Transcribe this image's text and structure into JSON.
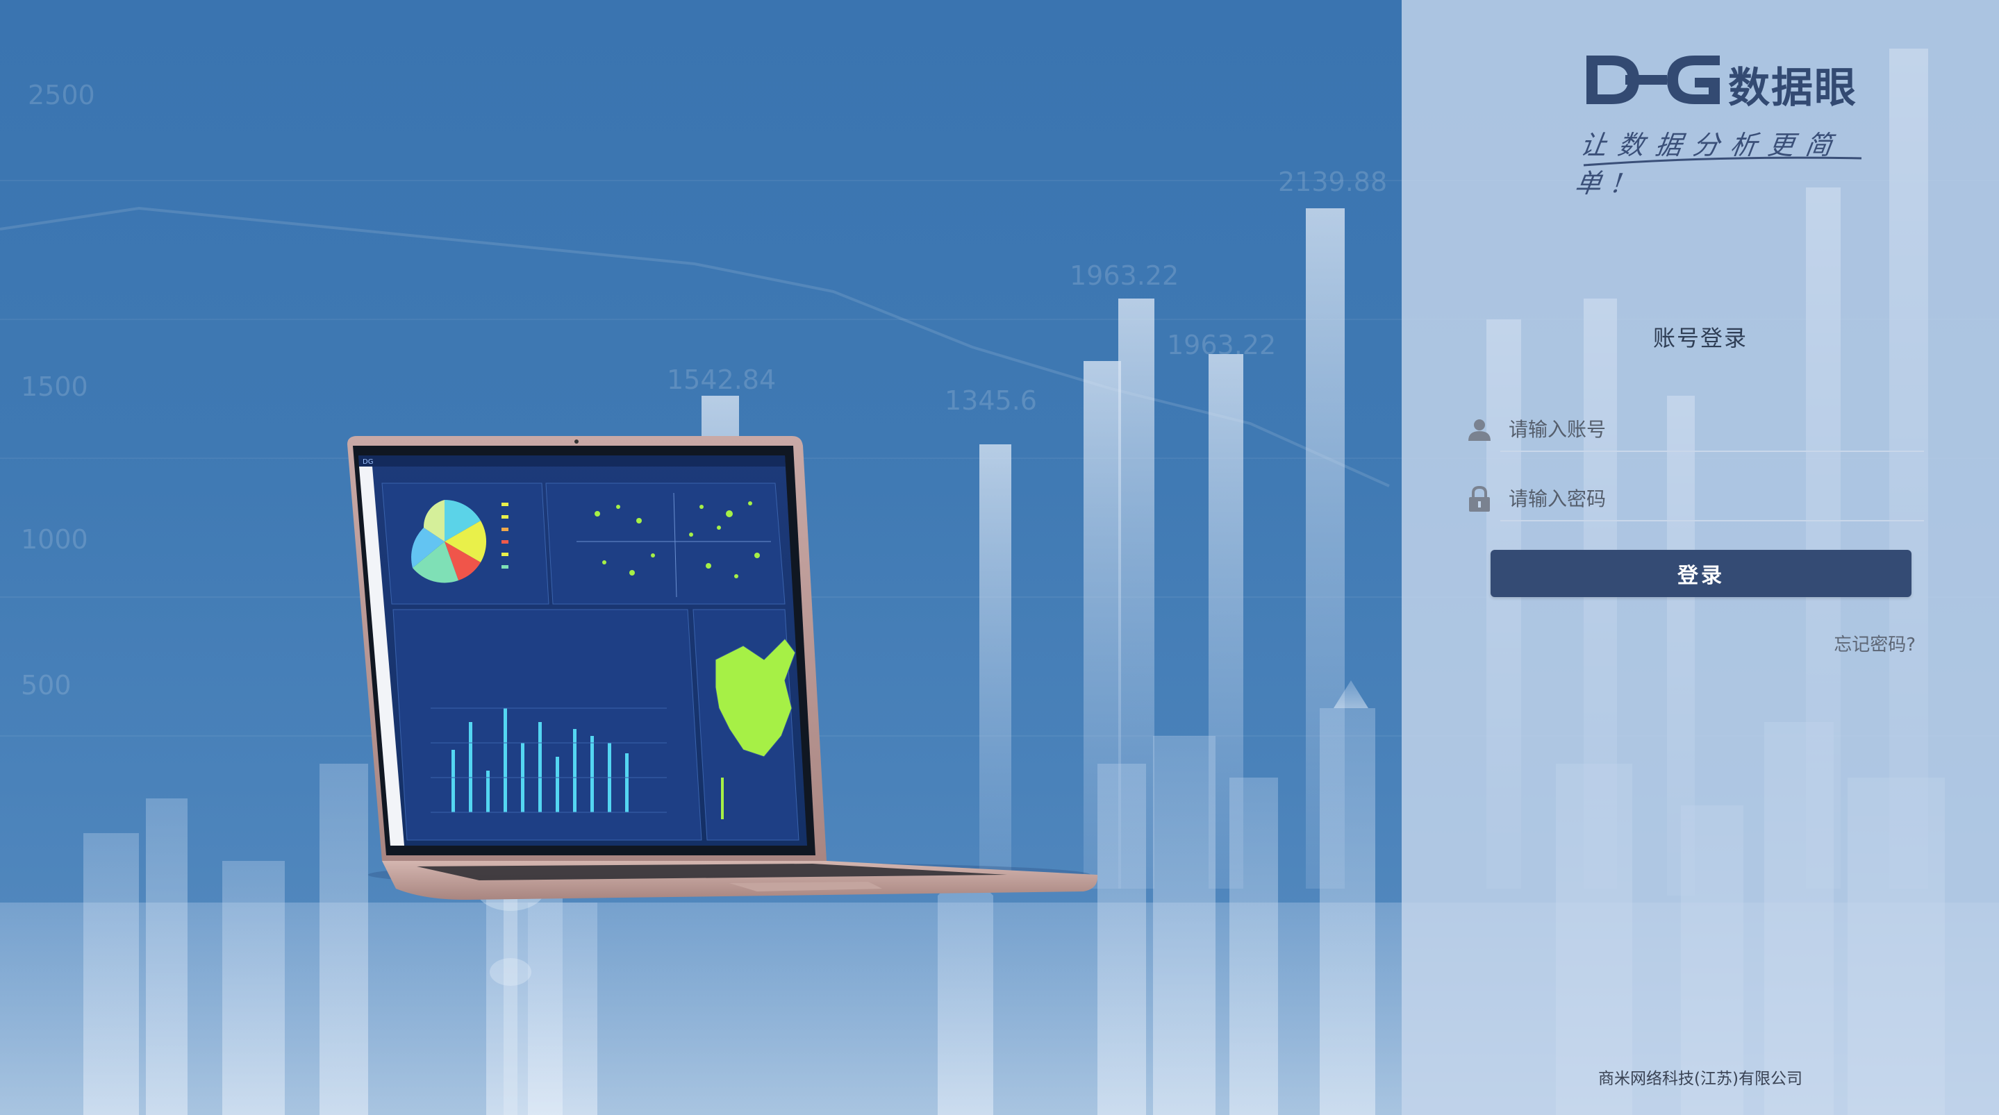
{
  "brand": {
    "name": "数据眼",
    "slogan": "让数据分析更简单!"
  },
  "background": {
    "numbers": [
      "2500",
      "2139.88",
      "1963.22",
      "1963.22",
      "1542.84",
      "1345.6",
      "1500",
      "1000",
      "500"
    ]
  },
  "login": {
    "title": "账号登录",
    "account_placeholder": "请输入账号",
    "password_placeholder": "请输入密码",
    "submit_label": "登录",
    "forgot_label": "忘记密码?"
  },
  "footer": {
    "company": "商米网络科技(江苏)有限公司"
  },
  "colors": {
    "panel_bg": "#c4d6ec",
    "button": "#344b74",
    "background_blue": "#3a74b0"
  },
  "icons": {
    "account": "user-icon",
    "password": "lock-icon"
  }
}
